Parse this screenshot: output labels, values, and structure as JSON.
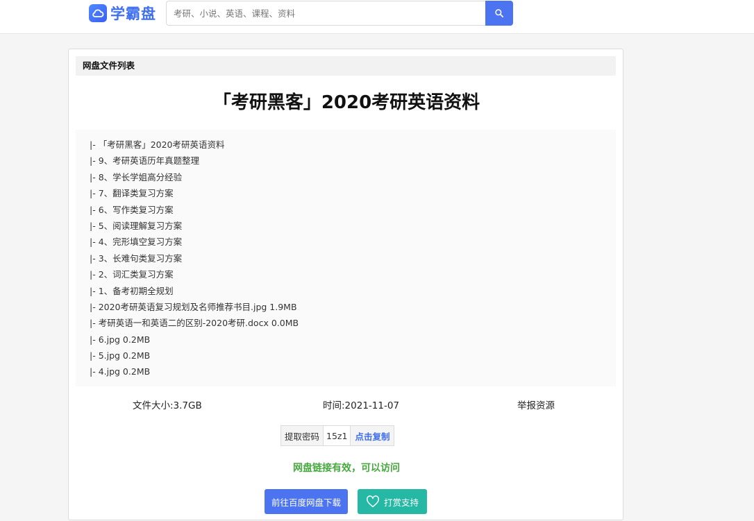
{
  "header": {
    "logo_text": "学霸盘",
    "search_placeholder": "考研、小说、英语、课程、资料"
  },
  "card": {
    "section_label": "网盘文件列表",
    "title": "「考研黑客」2020考研英语资料",
    "files": [
      "|- 「考研黑客」2020考研英语资料",
      "|- 9、考研英语历年真题整理",
      "|- 8、学长学姐高分经验",
      "|- 7、翻译类复习方案",
      "|- 6、写作类复习方案",
      "|- 5、阅读理解复习方案",
      "|- 4、完形填空复习方案",
      "|- 3、长难句类复习方案",
      "|- 2、词汇类复习方案",
      "|- 1、备考初期全规划",
      "|- 2020考研英语复习规划及名师推荐书目.jpg 1.9MB",
      "|- 考研英语一和英语二的区别-2020考研.docx 0.0MB",
      "|- 6.jpg 0.2MB",
      "|- 5.jpg 0.2MB",
      "|- 4.jpg 0.2MB"
    ],
    "file_size": "文件大小:3.7GB",
    "time": "时间:2021-11-07",
    "report": "举报资源",
    "password_label": "提取密码",
    "password_code": "15z1",
    "copy_label": "点击复制",
    "link_status": "网盘链接有效，可以访问",
    "download_button": "前往百度网盘下载",
    "support_button": "打赏支持"
  }
}
